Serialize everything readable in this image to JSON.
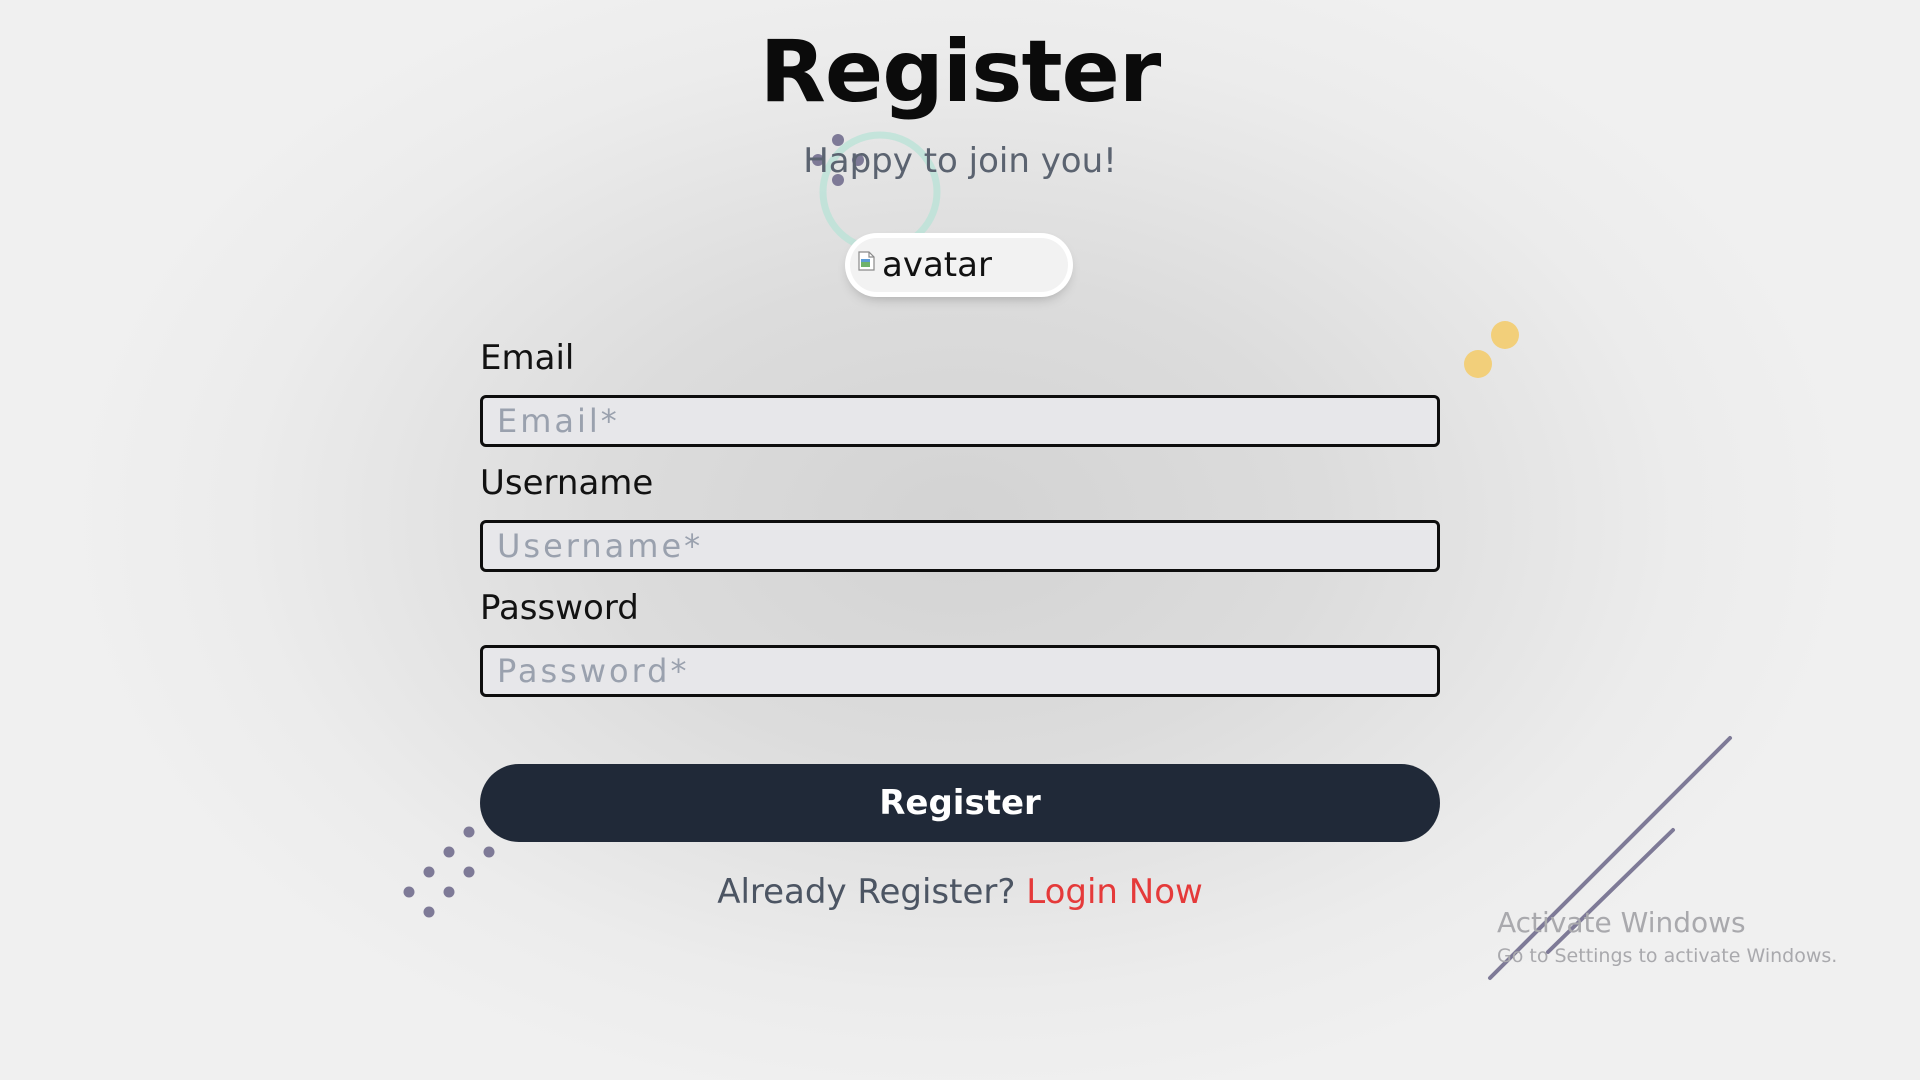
{
  "page": {
    "title": "Register",
    "subtitle": "Happy to join you!"
  },
  "avatar": {
    "alt_text": "avatar"
  },
  "form": {
    "email": {
      "label": "Email",
      "placeholder": "Email*",
      "value": ""
    },
    "username": {
      "label": "Username",
      "placeholder": "Username*",
      "value": ""
    },
    "password": {
      "label": "Password",
      "placeholder": "Password*",
      "value": ""
    },
    "submit_label": "Register"
  },
  "footer": {
    "prompt": "Already Register? ",
    "link_label": "Login Now"
  },
  "watermark": {
    "title": "Activate Windows",
    "subtitle": "Go to Settings to activate Windows."
  },
  "colors": {
    "button_bg": "#202938",
    "link": "#e53a3a",
    "dot_purple": "#7e7a97",
    "dot_yellow": "#f2cf7a",
    "ring_teal": "#b5e3d6"
  }
}
